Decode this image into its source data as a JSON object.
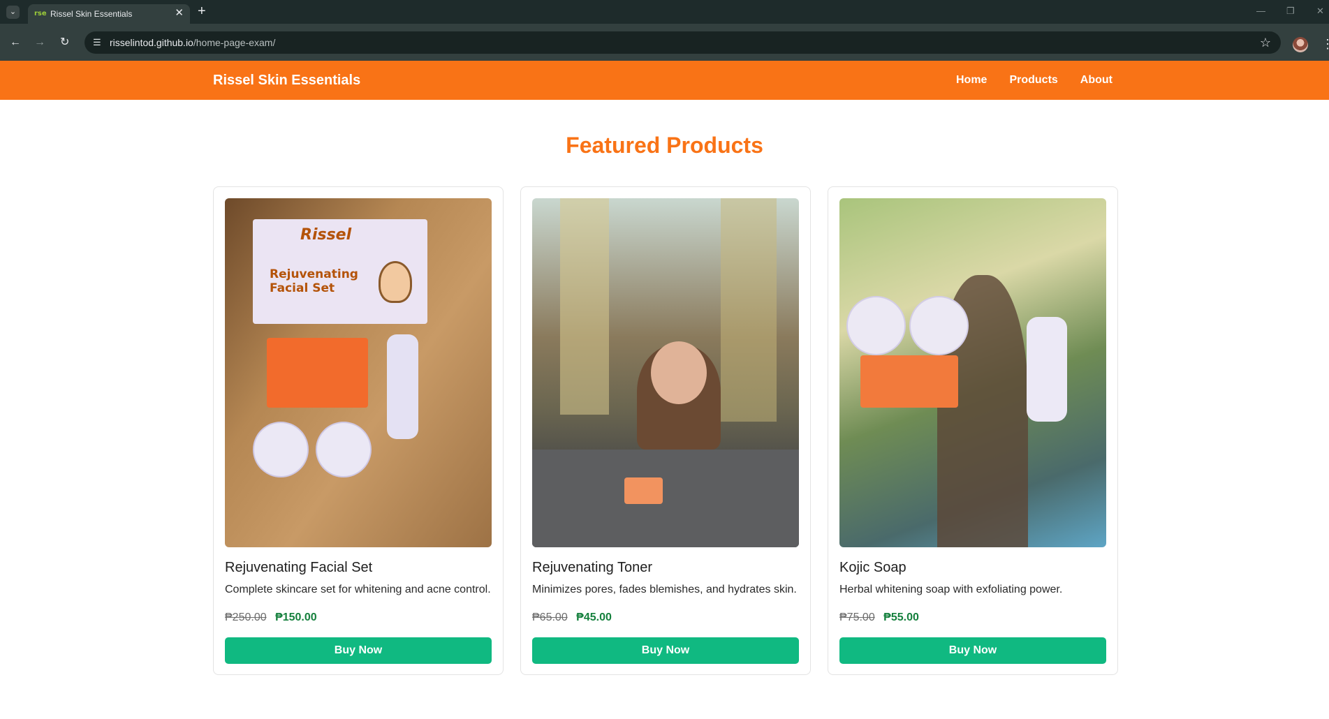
{
  "browser": {
    "tab_title": "Rissel Skin Essentials",
    "favicon_text": "rse",
    "url_host": "risselintod.github.io",
    "url_path": "/home-page-exam/"
  },
  "site": {
    "brand": "Rissel Skin Essentials",
    "nav": [
      "Home",
      "Products",
      "About"
    ]
  },
  "main": {
    "heading": "Featured Products",
    "products": [
      {
        "name": "Rejuvenating Facial Set",
        "description": "Complete skincare set for whitening and acne control.",
        "old_price": "₱250.00",
        "price": "₱150.00",
        "button": "Buy Now",
        "image_label": "Rejuvenating Facial Set",
        "image_brand": "Rissel"
      },
      {
        "name": "Rejuvenating Toner",
        "description": "Minimizes pores, fades blemishes, and hydrates skin.",
        "old_price": "₱65.00",
        "price": "₱45.00",
        "button": "Buy Now"
      },
      {
        "name": "Kojic Soap",
        "description": "Herbal whitening soap with exfoliating power.",
        "old_price": "₱75.00",
        "price": "₱55.00",
        "button": "Buy Now"
      }
    ]
  },
  "colors": {
    "header": "#f97316",
    "heading": "#f97316",
    "button": "#10b981",
    "price": "#15803d"
  }
}
